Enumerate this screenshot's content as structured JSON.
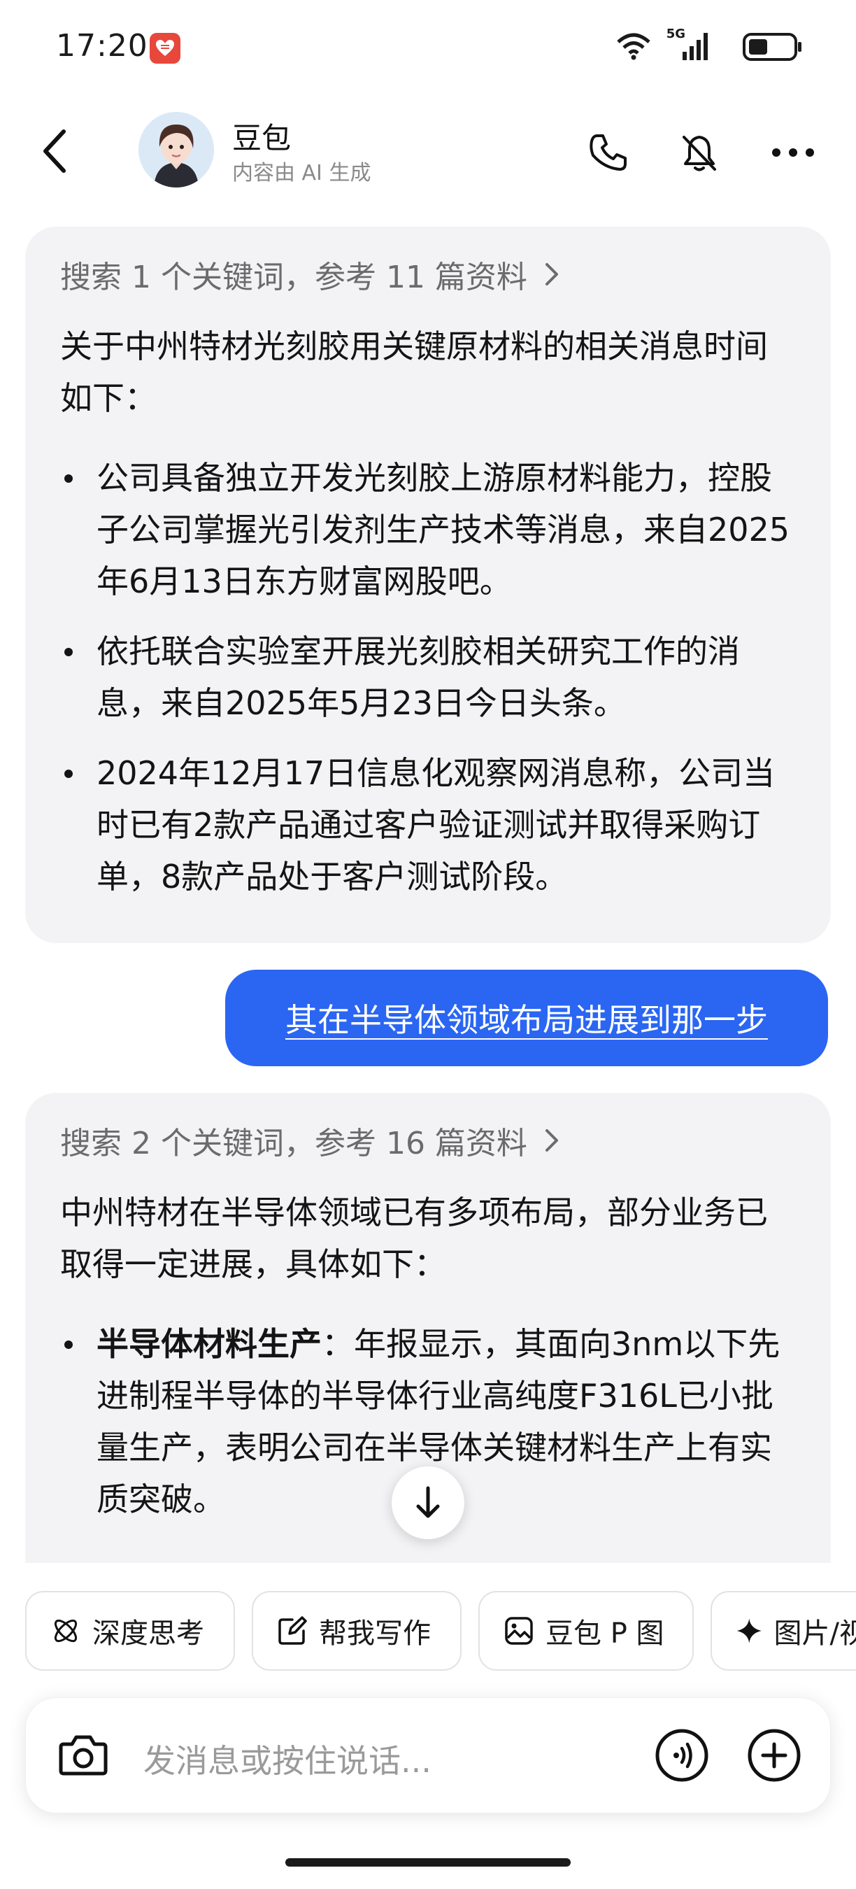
{
  "status_bar": {
    "time": "17:20",
    "network": "5G",
    "app_badge_icon": "heart-badge-icon"
  },
  "header": {
    "title": "豆包",
    "subtitle": "内容由 AI 生成"
  },
  "messages": [
    {
      "role": "bot",
      "search_summary": "搜索 1 个关键词，参考 11 篇资料",
      "intro": "关于中州特材光刻胶用关键原材料的相关消息时间如下：",
      "bullets": [
        {
          "bold": "",
          "text": "公司具备独立开发光刻胶上游原材料能力，控股子公司掌握光引发剂生产技术等消息，来自2025年6月13日东方财富网股吧。"
        },
        {
          "bold": "",
          "text": "依托联合实验室开展光刻胶相关研究工作的消息，来自2025年5月23日今日头条。"
        },
        {
          "bold": "",
          "text": "2024年12月17日信息化观察网消息称，公司当时已有2款产品通过客户验证测试并取得采购订单，8款产品处于客户测试阶段。"
        }
      ]
    },
    {
      "role": "user",
      "text": "其在半导体领域布局进展到那一步"
    },
    {
      "role": "bot",
      "search_summary": "搜索 2 个关键词，参考 16 篇资料",
      "intro": "中州特材在半导体领域已有多项布局，部分业务已取得一定进展，具体如下：",
      "bullets": [
        {
          "bold": "半导体材料生产",
          "text": "：年报显示，其面向3nm以下先进制程半导体的半导体行业高纯度F316L已小批量生产，表明公司在半导体关键材料生产上有实质突破。"
        }
      ]
    }
  ],
  "chips": [
    "深度思考",
    "帮我写作",
    "豆包 P 图",
    "图片/视频"
  ],
  "input": {
    "placeholder": "发消息或按住说话..."
  },
  "colors": {
    "user_bubble": "#2a66f2",
    "bot_bubble": "#f3f3f5"
  }
}
